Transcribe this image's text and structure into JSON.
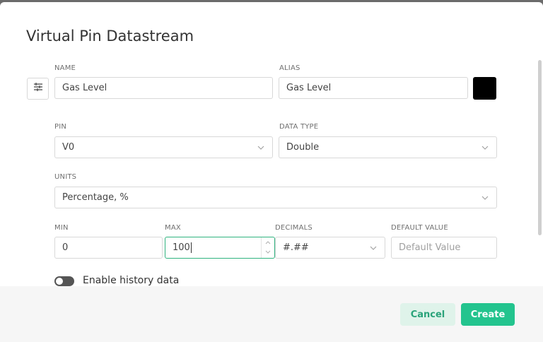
{
  "dialog": {
    "title": "Virtual Pin Datastream"
  },
  "colors": {
    "accent": "#23c48e",
    "cancel_bg": "#dff3ea",
    "cancel_text": "#2aa37a",
    "swatch": "#000000"
  },
  "fields": {
    "name": {
      "label": "NAME",
      "value": "Gas Level"
    },
    "alias": {
      "label": "ALIAS",
      "value": "Gas Level"
    },
    "pin": {
      "label": "PIN",
      "value": "V0"
    },
    "data_type": {
      "label": "DATA TYPE",
      "value": "Double"
    },
    "units": {
      "label": "UNITS",
      "value": "Percentage, %"
    },
    "min": {
      "label": "MIN",
      "value": "0"
    },
    "max": {
      "label": "MAX",
      "value": "100"
    },
    "decimals": {
      "label": "DECIMALS",
      "value": "#.##"
    },
    "default_value": {
      "label": "DEFAULT VALUE",
      "placeholder": "Default Value"
    }
  },
  "icons": {
    "settings": "sliders-icon",
    "dropdown": "chevron-down-icon",
    "stepper_up": "chevron-up-icon",
    "stepper_down": "chevron-down-icon"
  },
  "history": {
    "label": "Enable history data",
    "enabled": false
  },
  "footer": {
    "cancel_label": "Cancel",
    "create_label": "Create"
  }
}
